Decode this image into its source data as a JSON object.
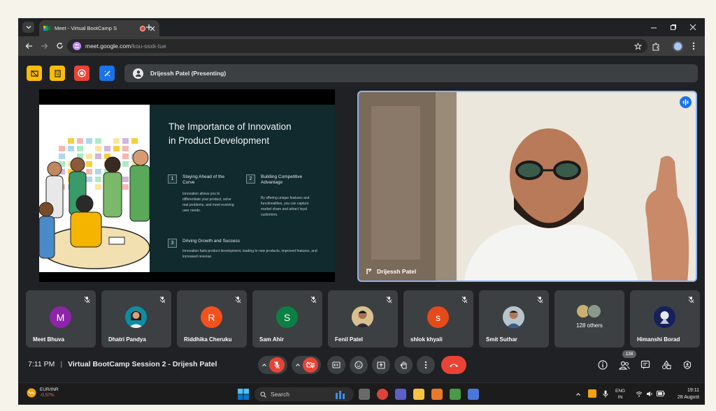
{
  "browser": {
    "tab_title": "Meet - Virtual BootCamp S",
    "url_domain": "meet.google.com",
    "url_path": "/kou-ssxk-tue"
  },
  "meet": {
    "presenting_label": "Drijessh Patel (Presenting)",
    "slide": {
      "title_line1": "The Importance of Innovation",
      "title_line2": "in Product Development",
      "points": [
        {
          "num": "1",
          "heading": "Staying Ahead of the Curve",
          "text": "Innovation allows you to differentiate your product, solve real problems, and meet evolving user needs."
        },
        {
          "num": "2",
          "heading": "Building Competitive Advantage",
          "text": "By offering unique features and functionalities, you can capture market share and attract loyal customers."
        },
        {
          "num": "3",
          "heading": "Driving Growth and Success",
          "text": "Innovation fuels product development, leading to new products, improved features, and increased revenue."
        }
      ]
    },
    "speaker_name": "Drijessh Patel",
    "participants": [
      {
        "initial": "M",
        "name": "Meet Bhuva",
        "color": "#8e24aa"
      },
      {
        "initial": "",
        "name": "Dhatri Pandya",
        "color": "#0b8ea3"
      },
      {
        "initial": "R",
        "name": "Riddhika Cheruku",
        "color": "#f4511e"
      },
      {
        "initial": "S",
        "name": "Sam Ahir",
        "color": "#0b8043"
      },
      {
        "initial": "",
        "name": "Fenil Patel",
        "color": "#e0c080"
      },
      {
        "initial": "s",
        "name": "shlok khyali",
        "color": "#e64a19"
      },
      {
        "initial": "",
        "name": "Smit Suthar",
        "color": "#9aa7b0"
      },
      {
        "initial": "",
        "name": "128 others",
        "color": "#7a8a6a"
      },
      {
        "initial": "",
        "name": "Himanshi Borad",
        "color": "#1a237e"
      }
    ],
    "time": "7:11 PM",
    "meeting_title": "Virtual BootCamp Session 2 - Drijesh Patel",
    "people_count": "138"
  },
  "taskbar": {
    "stock_pair": "EUR/INR",
    "stock_change": "-0.57%",
    "search_placeholder": "Search",
    "lang_top": "ENG",
    "lang_bottom": "IN",
    "clock_time": "19:11",
    "clock_date": "28 August"
  },
  "colors": {
    "accent": "#8ab4f8",
    "end_call": "#ea4335",
    "meet_bg": "#202124"
  }
}
